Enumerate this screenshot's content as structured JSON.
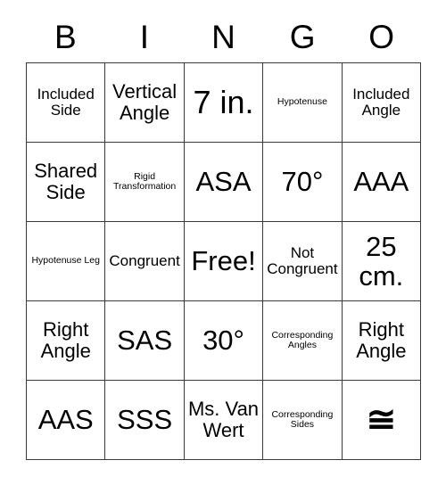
{
  "card": {
    "title_letters": [
      "B",
      "I",
      "N",
      "G",
      "O"
    ],
    "columns": 5,
    "rows": 5,
    "border_color": "#3a3a3a",
    "background_color": "#ffffff",
    "text_color": "#000000",
    "cells": [
      [
        {
          "text": "Included Side",
          "size": "sz-sm"
        },
        {
          "text": "Vertical Angle",
          "size": "sz-md"
        },
        {
          "text": "7 in.",
          "size": "sz-xl"
        },
        {
          "text": "Hypotenuse",
          "size": "sz-xs"
        },
        {
          "text": "Included Angle",
          "size": "sz-sm"
        }
      ],
      [
        {
          "text": "Shared Side",
          "size": "sz-md"
        },
        {
          "text": "Rigid Transformation",
          "size": "sz-xs"
        },
        {
          "text": "ASA",
          "size": "sz-lg"
        },
        {
          "text": "70°",
          "size": "sz-lg"
        },
        {
          "text": "AAA",
          "size": "sz-lg"
        }
      ],
      [
        {
          "text": "Hypotenuse Leg",
          "size": "sz-xs"
        },
        {
          "text": "Congruent",
          "size": "sz-sm"
        },
        {
          "text": "Free!",
          "size": "sz-lg"
        },
        {
          "text": "Not Congruent",
          "size": "sz-sm"
        },
        {
          "text": "25 cm.",
          "size": "sz-lg"
        }
      ],
      [
        {
          "text": "Right Angle",
          "size": "sz-md"
        },
        {
          "text": "SAS",
          "size": "sz-lg"
        },
        {
          "text": "30°",
          "size": "sz-lg"
        },
        {
          "text": "Corresponding Angles",
          "size": "sz-xs"
        },
        {
          "text": "Right Angle",
          "size": "sz-md"
        }
      ],
      [
        {
          "text": "AAS",
          "size": "sz-lg"
        },
        {
          "text": "SSS",
          "size": "sz-lg"
        },
        {
          "text": "Ms. Van Wert",
          "size": "sz-md"
        },
        {
          "text": "Corresponding Sides",
          "size": "sz-xs"
        },
        {
          "text": "≅",
          "size": "symbol"
        }
      ]
    ]
  }
}
